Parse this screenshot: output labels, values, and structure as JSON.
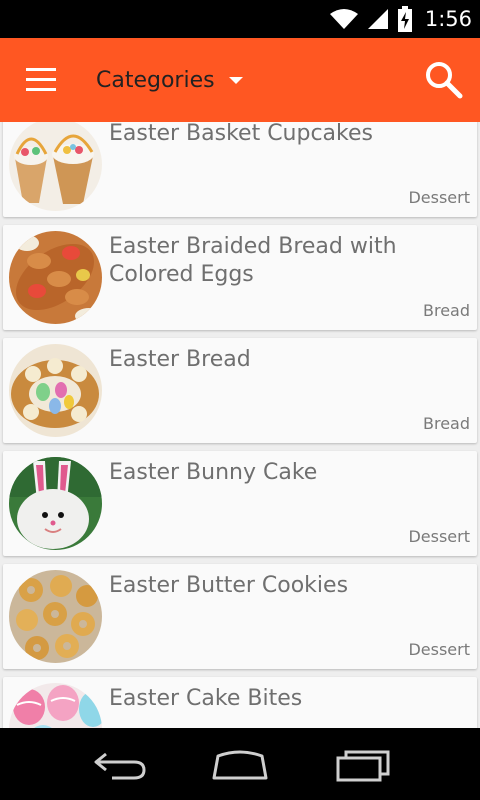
{
  "status_bar": {
    "time": "1:56"
  },
  "app_bar": {
    "title": "Categories"
  },
  "recipes": [
    {
      "title": "Easter Basket Cupcakes",
      "category": "Dessert"
    },
    {
      "title": "Easter Braided Bread with Colored Eggs",
      "category": "Bread"
    },
    {
      "title": "Easter Bread",
      "category": "Bread"
    },
    {
      "title": "Easter Bunny Cake",
      "category": "Dessert"
    },
    {
      "title": "Easter Butter Cookies",
      "category": "Dessert"
    },
    {
      "title": "Easter Cake Bites",
      "category": ""
    }
  ],
  "colors": {
    "accent": "#ff5722",
    "status_bar": "#000000",
    "nav_bar": "#000000",
    "card": "#fafafa",
    "background": "#eeeeee"
  }
}
